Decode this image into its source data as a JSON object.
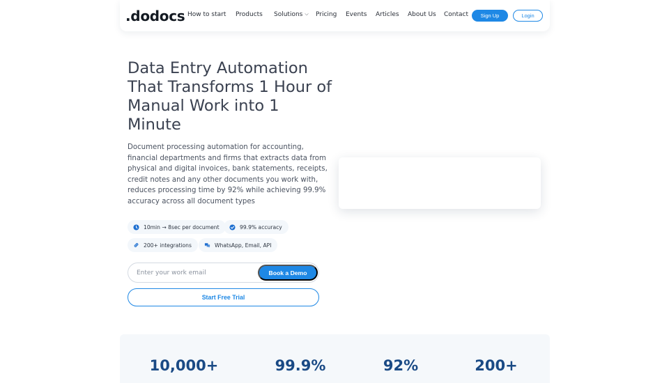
{
  "nav": {
    "logo": ".dodocs",
    "items": [
      "How to start",
      "Products",
      "Solutions",
      "Pricing",
      "Events",
      "Articles",
      "About Us",
      "Contact"
    ],
    "signup_label": "Sign Up",
    "login_label": "Login"
  },
  "hero": {
    "title": "Data Entry Automation That Transforms 1 Hour of Manual Work into 1 Minute",
    "description": "Document processing automation for accounting, financial departments and firms that extracts data from physical and digital invoices, bank statements, receipts, credit notes and any other documents you work with, reduces processing time by 92% while achieving 99.9% accuracy across all document types",
    "chips": [
      {
        "icon": "clock-icon",
        "label": "10min → 8sec per document"
      },
      {
        "icon": "check-circle-icon",
        "label": "99.9% accuracy"
      },
      {
        "icon": "link-icon",
        "label": "200+ integrations"
      },
      {
        "icon": "chat-icon",
        "label": "WhatsApp, Email, API"
      }
    ],
    "email_placeholder": "Enter your work email",
    "demo_label": "Book a Demo",
    "trial_label": "Start Free Trial"
  },
  "stats": [
    "10,000+",
    "99.9%",
    "92%",
    "200+"
  ],
  "colors": {
    "accent": "#1e88e5",
    "stat": "#1a4a85"
  }
}
